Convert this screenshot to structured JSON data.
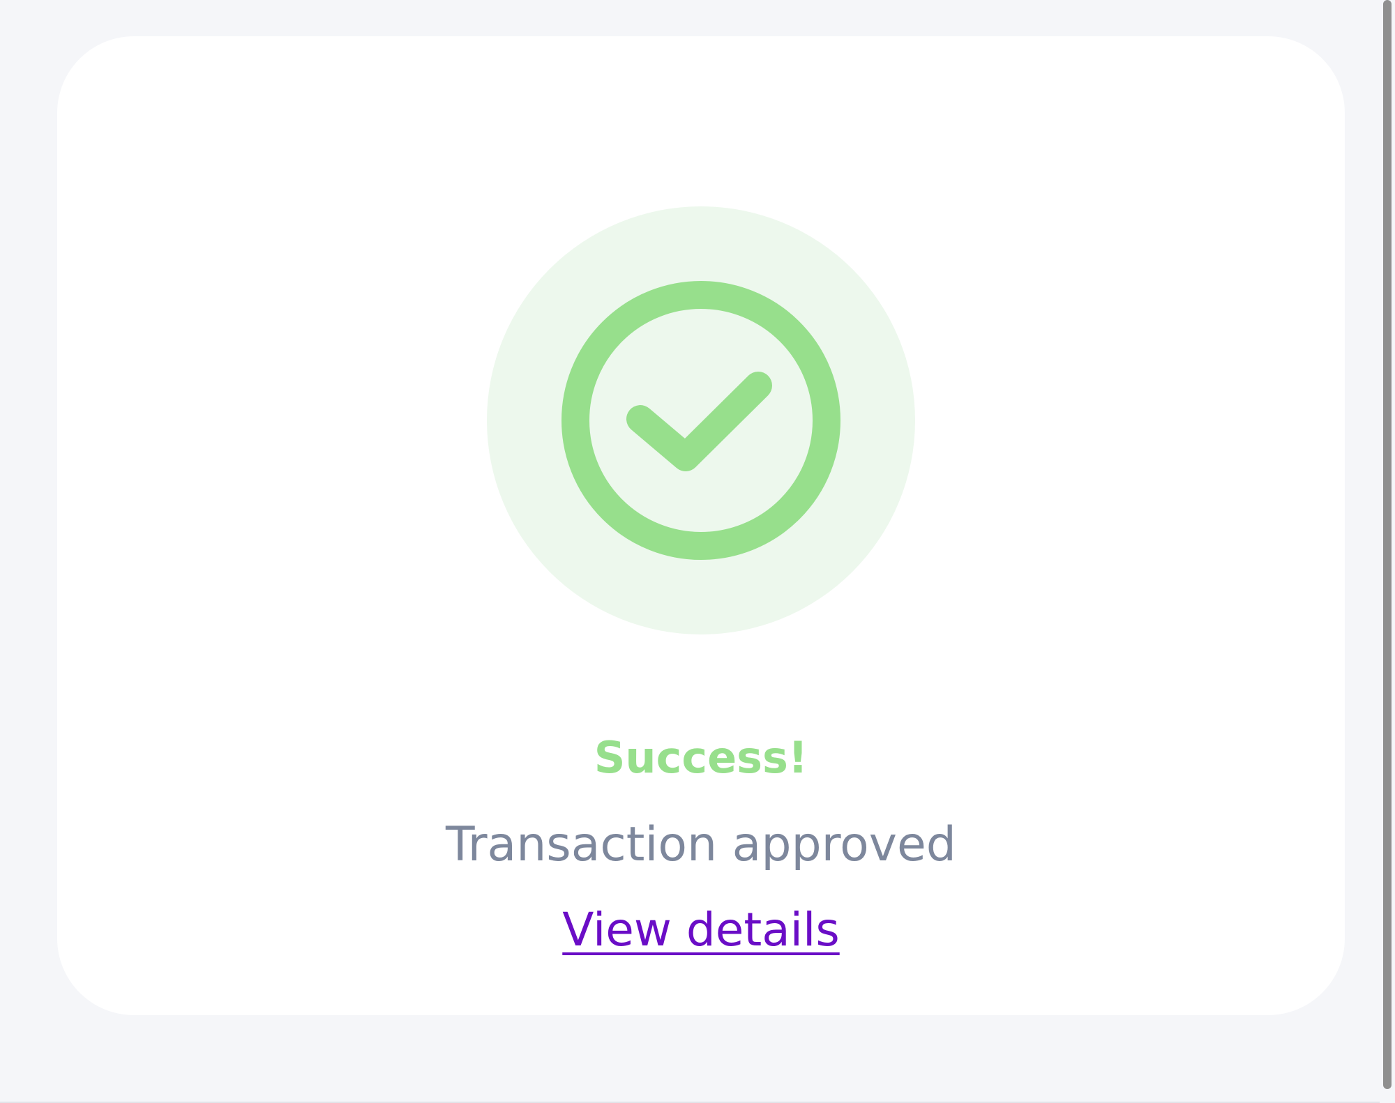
{
  "colors": {
    "page_background": "#f5f6f9",
    "card_background": "#ffffff",
    "success_green": "#97df8c",
    "halo_green": "#edf8ed",
    "subtitle_gray": "#7d879c",
    "link_purple": "#6a0dc6",
    "scrollbar_thumb": "#8f8f8f"
  },
  "status": {
    "icon": "check-circle-icon",
    "title": "Success!",
    "message": "Transaction approved",
    "link_label": "View details"
  }
}
